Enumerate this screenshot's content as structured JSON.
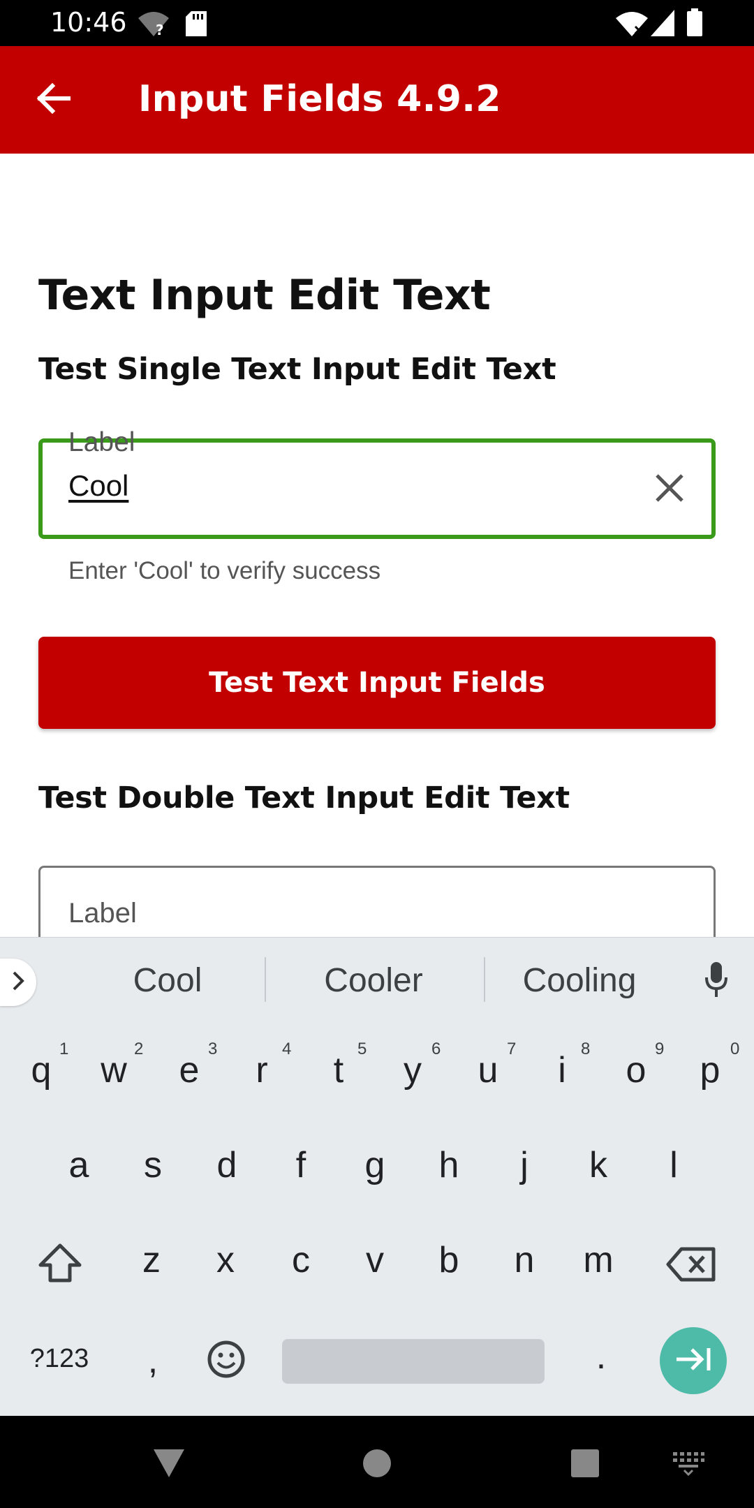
{
  "status_bar": {
    "time": "10:46",
    "icons": [
      "wifi-unknown-icon",
      "sd-card-icon",
      "wifi-signal-icon",
      "cell-signal-icon",
      "battery-icon"
    ]
  },
  "app_bar": {
    "title": "Input Fields 4.9.2",
    "back_icon": "arrow-back-icon",
    "background": "#c20000"
  },
  "content": {
    "page_heading": "Text Input Edit Text",
    "single_section_heading": "Test Single Text Input Edit Text",
    "single_field": {
      "label": "Label",
      "value": "Cool",
      "helper_text": "Enter 'Cool' to verify success",
      "state_color": "#3a9a1a",
      "clear_icon": "close-icon"
    },
    "test_button_label": "Test Text Input Fields",
    "double_section_heading": "Test Double Text Input Edit Text",
    "double_field": {
      "label": "Label"
    }
  },
  "keyboard": {
    "suggestions": [
      "Cool",
      "Cooler",
      "Cooling"
    ],
    "row1": [
      {
        "key": "q",
        "hint": "1"
      },
      {
        "key": "w",
        "hint": "2"
      },
      {
        "key": "e",
        "hint": "3"
      },
      {
        "key": "r",
        "hint": "4"
      },
      {
        "key": "t",
        "hint": "5"
      },
      {
        "key": "y",
        "hint": "6"
      },
      {
        "key": "u",
        "hint": "7"
      },
      {
        "key": "i",
        "hint": "8"
      },
      {
        "key": "o",
        "hint": "9"
      },
      {
        "key": "p",
        "hint": "0"
      }
    ],
    "row2": [
      "a",
      "s",
      "d",
      "f",
      "g",
      "h",
      "j",
      "k",
      "l"
    ],
    "row3": [
      "z",
      "x",
      "c",
      "v",
      "b",
      "n",
      "m"
    ],
    "symbols_label": "?123",
    "comma": ",",
    "period": ".",
    "enter_color": "#4dbba8"
  },
  "nav_bar": {
    "icons": [
      "back-triangle-icon",
      "home-circle-icon",
      "recents-square-icon",
      "keyboard-switch-icon"
    ]
  }
}
